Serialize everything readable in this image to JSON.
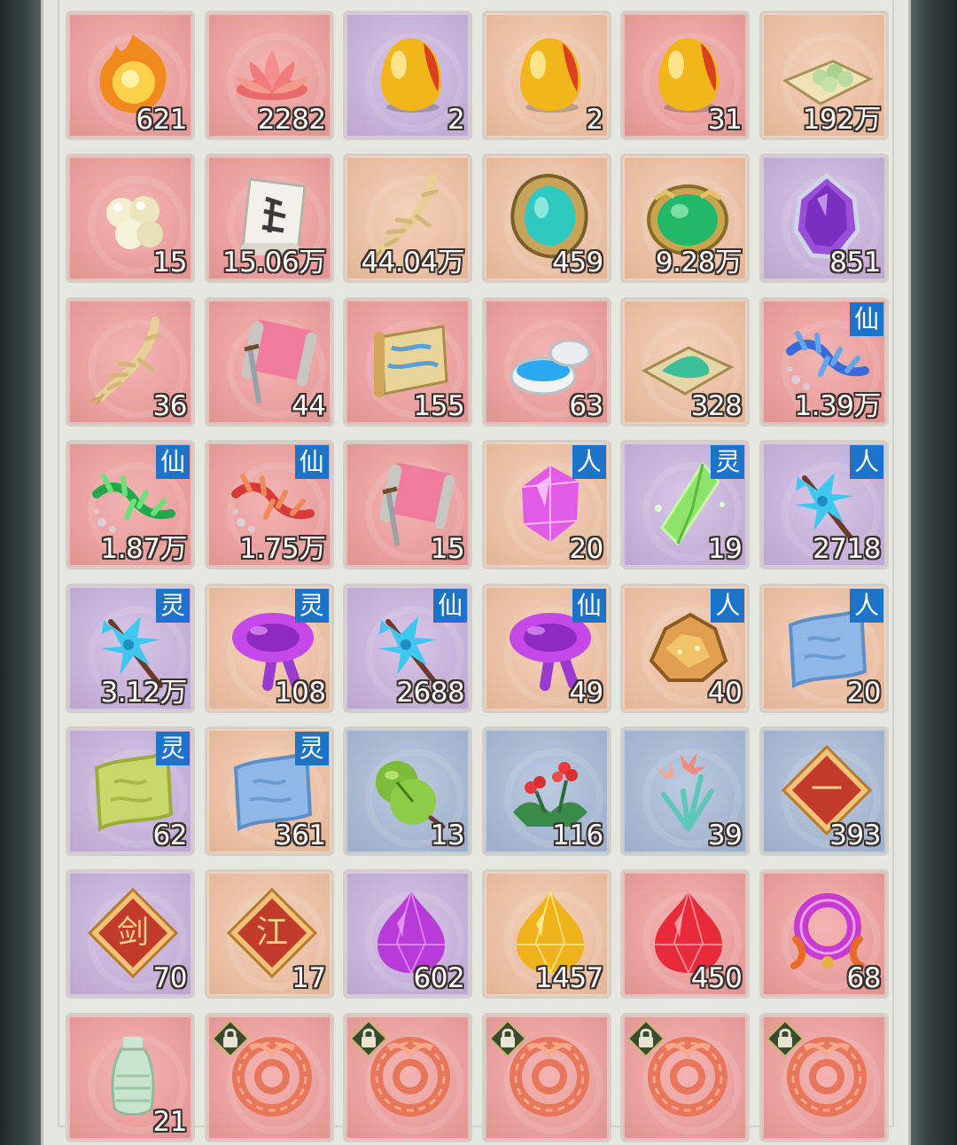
{
  "colors": {
    "red_slot": "#eaa2a0",
    "orange_slot": "#ebc1a6",
    "purple_slot": "#c8b3da",
    "blue_slot": "#aab9d2",
    "tag_blue": "#1d73c7"
  },
  "inventory": {
    "slots": [
      {
        "icon": "fire-orb-icon",
        "count": "621",
        "tag": ""
      },
      {
        "icon": "lotus-icon",
        "count": "2282",
        "tag": ""
      },
      {
        "icon": "golden-egg-icon",
        "count": "2",
        "tag": ""
      },
      {
        "icon": "golden-egg-icon",
        "count": "2",
        "tag": ""
      },
      {
        "icon": "golden-egg-icon",
        "count": "31",
        "tag": ""
      },
      {
        "icon": "pill-tray-icon",
        "count": "192万",
        "tag": ""
      },
      {
        "icon": "pearls-icon",
        "count": "15",
        "tag": ""
      },
      {
        "icon": "scroll-paper-icon",
        "count": "15.06万",
        "tag": ""
      },
      {
        "icon": "ginseng-root-icon",
        "count": "44.04万",
        "tag": ""
      },
      {
        "icon": "jade-amulet-icon",
        "count": "459",
        "tag": ""
      },
      {
        "icon": "emerald-ornament-icon",
        "count": "9.28万",
        "tag": ""
      },
      {
        "icon": "purple-crystal-icon",
        "count": "851",
        "tag": ""
      },
      {
        "icon": "ginseng-root-icon",
        "count": "36",
        "tag": ""
      },
      {
        "icon": "sword-scroll-icon",
        "count": "44",
        "tag": ""
      },
      {
        "icon": "map-scroll-icon",
        "count": "155",
        "tag": ""
      },
      {
        "icon": "ointment-jar-icon",
        "count": "63",
        "tag": ""
      },
      {
        "icon": "herb-powder-icon",
        "count": "328",
        "tag": ""
      },
      {
        "icon": "blue-dragon-herb-icon",
        "count": "1.39万",
        "tag": "仙"
      },
      {
        "icon": "green-dragon-herb-icon",
        "count": "1.87万",
        "tag": "仙"
      },
      {
        "icon": "red-dragon-herb-icon",
        "count": "1.75万",
        "tag": "仙"
      },
      {
        "icon": "sword-scroll-icon",
        "count": "15",
        "tag": ""
      },
      {
        "icon": "pink-gem-icon",
        "count": "20",
        "tag": "人"
      },
      {
        "icon": "green-crystal-icon",
        "count": "19",
        "tag": "灵"
      },
      {
        "icon": "blue-flower-branch-icon",
        "count": "2718",
        "tag": "人"
      },
      {
        "icon": "blue-flower-branch-icon",
        "count": "3.12万",
        "tag": "灵"
      },
      {
        "icon": "purple-mushroom-icon",
        "count": "108",
        "tag": "灵"
      },
      {
        "icon": "blue-flower-branch-icon",
        "count": "2688",
        "tag": "仙"
      },
      {
        "icon": "purple-mushroom-icon",
        "count": "49",
        "tag": "仙"
      },
      {
        "icon": "gold-ore-icon",
        "count": "40",
        "tag": "人"
      },
      {
        "icon": "blue-cloth-icon",
        "count": "20",
        "tag": "人"
      },
      {
        "icon": "green-cloth-icon",
        "count": "62",
        "tag": "灵"
      },
      {
        "icon": "blue-cloth-icon",
        "count": "361",
        "tag": "灵"
      },
      {
        "icon": "green-gourd-icon",
        "count": "13",
        "tag": ""
      },
      {
        "icon": "red-berry-plant-icon",
        "count": "116",
        "tag": ""
      },
      {
        "icon": "lily-plant-icon",
        "count": "39",
        "tag": ""
      },
      {
        "icon": "seal-token-icon",
        "count": "393",
        "tag": "",
        "glyph": "一"
      },
      {
        "icon": "seal-token-icon",
        "count": "70",
        "tag": "",
        "glyph": "剑"
      },
      {
        "icon": "seal-token-icon",
        "count": "17",
        "tag": "",
        "glyph": "江"
      },
      {
        "icon": "purple-gem-drop-icon",
        "count": "602",
        "tag": ""
      },
      {
        "icon": "yellow-gem-drop-icon",
        "count": "1457",
        "tag": ""
      },
      {
        "icon": "red-gem-drop-icon",
        "count": "450",
        "tag": ""
      },
      {
        "icon": "fish-ring-icon",
        "count": "68",
        "tag": ""
      },
      {
        "icon": "porcelain-bottle-icon",
        "count": "21",
        "tag": ""
      },
      {
        "icon": "coral-ring-icon",
        "count": "",
        "tag": "",
        "locked": true
      },
      {
        "icon": "coral-ring-icon",
        "count": "",
        "tag": "",
        "locked": true
      },
      {
        "icon": "coral-ring-icon",
        "count": "",
        "tag": "",
        "locked": true
      },
      {
        "icon": "coral-ring-icon",
        "count": "",
        "tag": "",
        "locked": true
      },
      {
        "icon": "coral-ring-icon",
        "count": "",
        "tag": "",
        "locked": true
      }
    ]
  }
}
